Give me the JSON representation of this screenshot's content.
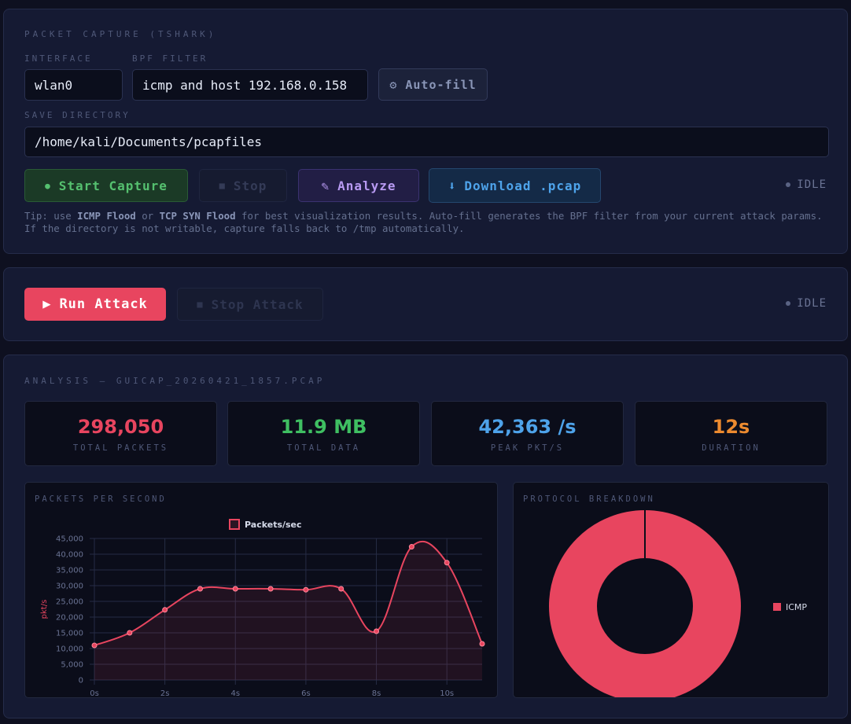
{
  "capture": {
    "title": "PACKET CAPTURE (TSHARK)",
    "interface_label": "INTERFACE",
    "interface_value": "wlan0",
    "bpf_label": "BPF FILTER",
    "bpf_value": "icmp and host 192.168.0.158",
    "autofill_icon": "⚙",
    "autofill_label": "Auto-fill",
    "save_dir_label": "SAVE DIRECTORY",
    "save_dir_value": "/home/kali/Documents/pcapfiles",
    "start_icon": "●",
    "start_label": "Start Capture",
    "stop_icon": "■",
    "stop_label": "Stop",
    "analyze_icon": "✎",
    "analyze_label": "Analyze",
    "download_icon": "⬇",
    "download_label": "Download .pcap",
    "status": "IDLE",
    "tip_prefix": "Tip: use ",
    "tip_icmp": "ICMP Flood",
    "tip_or": " or ",
    "tip_syn": "TCP SYN Flood",
    "tip_rest": " for best visualization results. Auto-fill generates the BPF filter from your current attack params. If the directory is not writable, capture falls back to /tmp automatically."
  },
  "attack": {
    "run_icon": "▶",
    "run_label": "Run Attack",
    "stop_icon": "■",
    "stop_label": "Stop Attack",
    "status": "IDLE"
  },
  "analysis": {
    "title": "ANALYSIS — GUICAP_20260421_1857.PCAP",
    "stats": [
      {
        "value": "298,050",
        "caption": "TOTAL PACKETS",
        "color": "#e8455f"
      },
      {
        "value": "11.9 MB",
        "caption": "TOTAL DATA",
        "color": "#3fbf62"
      },
      {
        "value": "42,363 /s",
        "caption": "PEAK PKT/S",
        "color": "#4ea3ea"
      },
      {
        "value": "12s",
        "caption": "DURATION",
        "color": "#ec8a2f"
      }
    ],
    "pps_title": "PACKETS PER SECOND",
    "proto_title": "PROTOCOL BREAKDOWN"
  },
  "colors": {
    "accent": "#e8455f",
    "green": "#3fbf62",
    "blue": "#4ea3ea",
    "orange": "#ec8a2f"
  },
  "chart_data": [
    {
      "type": "line",
      "title": "PACKETS PER SECOND",
      "ylabel": "pkt/s",
      "xlabel": "",
      "x": [
        "0s",
        "1s",
        "2s",
        "3s",
        "4s",
        "5s",
        "6s",
        "7s",
        "8s",
        "9s",
        "10s",
        "11s"
      ],
      "x_tick_labels": [
        "0s",
        "2s",
        "4s",
        "6s",
        "8s",
        "10s"
      ],
      "series": [
        {
          "name": "Packets/sec",
          "values": [
            11000,
            15000,
            22300,
            29000,
            29000,
            29000,
            28700,
            29000,
            15500,
            42363,
            37300,
            11500
          ]
        }
      ],
      "ylim": [
        0,
        45000
      ],
      "y_ticks": [
        "0",
        "5,000",
        "10,000",
        "15,000",
        "20,000",
        "25,000",
        "30,000",
        "35,000",
        "40,000",
        "45,000"
      ],
      "grid": true,
      "legend": "top-center",
      "color": "#e8455f"
    },
    {
      "type": "pie",
      "title": "PROTOCOL BREAKDOWN",
      "categories": [
        "ICMP"
      ],
      "values": [
        100
      ],
      "legend": "right",
      "color": "#e8455f"
    }
  ]
}
